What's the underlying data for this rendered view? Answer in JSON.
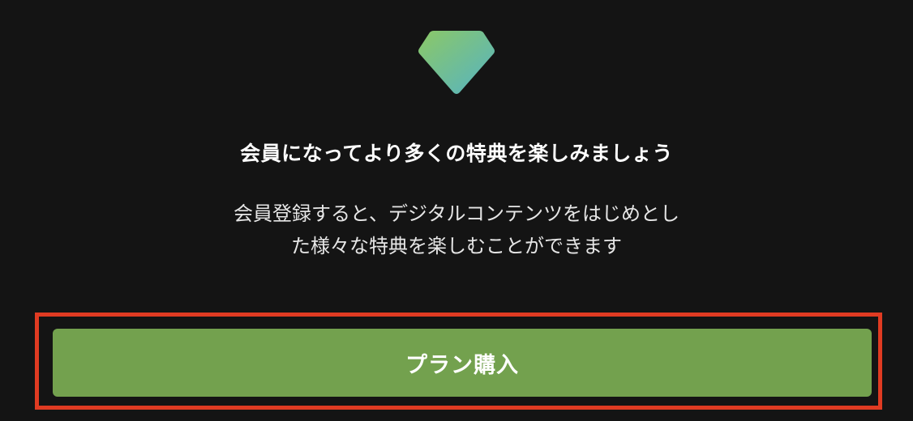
{
  "icon": {
    "name": "diamond-icon",
    "gradient_start": "#8cc866",
    "gradient_end": "#5ab7bf"
  },
  "promo": {
    "headline": "会員になってより多くの特典を楽しみましょう",
    "body_line1": "会員登録すると、デジタルコンテンツをはじめとし",
    "body_line2": "た様々な特典を楽しむことができます"
  },
  "cta": {
    "label": "プラン購入",
    "color": "#73a14e"
  },
  "highlight": {
    "color": "#e03b22"
  }
}
